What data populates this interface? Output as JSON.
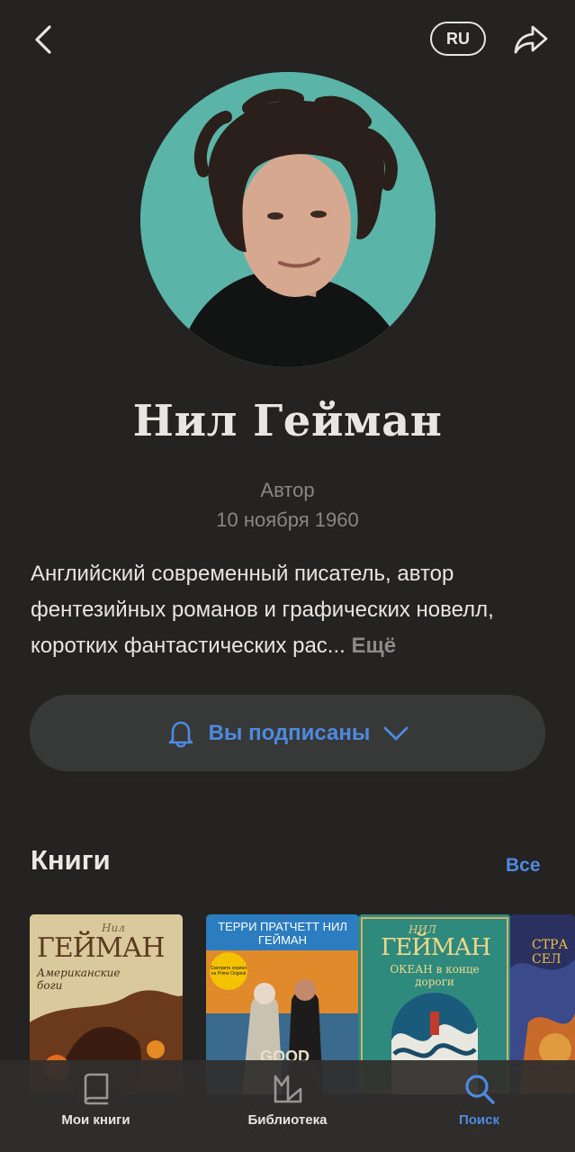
{
  "header": {
    "back_icon": "chevron-left-icon",
    "language_label": "RU",
    "share_icon": "share-arrow-icon"
  },
  "author": {
    "name": "Нил Гейман",
    "role": "Автор",
    "birth_date": "10 ноября 1960",
    "bio": "Английский современный писатель, автор фентезийных романов и графических новелл, коротких фантастических рас...",
    "bio_more": "Ещё"
  },
  "subscribe": {
    "icon": "bell-icon",
    "label": "Вы подписаны",
    "chevron": "chevron-down-icon"
  },
  "books_section": {
    "title": "Книги",
    "all_link": "Все",
    "books": [
      {
        "author_small": "Нил",
        "author": "ГЕЙМАН",
        "title": "Американские боги"
      },
      {
        "author": "ТЕРРИ ПРАТЧЕТТ НИЛ ГЕЙМАН",
        "badge": "Смотрите сериал на Prime Original",
        "title": "GOOD"
      },
      {
        "author_small": "НИЛ",
        "author": "ГЕЙМАН",
        "title": "ОКЕАН в конце дороги"
      },
      {
        "title": "СТРА СЕЛ"
      }
    ]
  },
  "bottom_nav": {
    "items": [
      {
        "label": "Мои книги",
        "icon": "book-icon"
      },
      {
        "label": "Библиотека",
        "icon": "library-icon"
      },
      {
        "label": "Поиск",
        "icon": "search-icon"
      }
    ]
  },
  "colors": {
    "background": "#242322",
    "accent": "#4d8ae0",
    "text": "#e9e6e1",
    "muted": "#8a8782",
    "button_bg": "#373838"
  }
}
